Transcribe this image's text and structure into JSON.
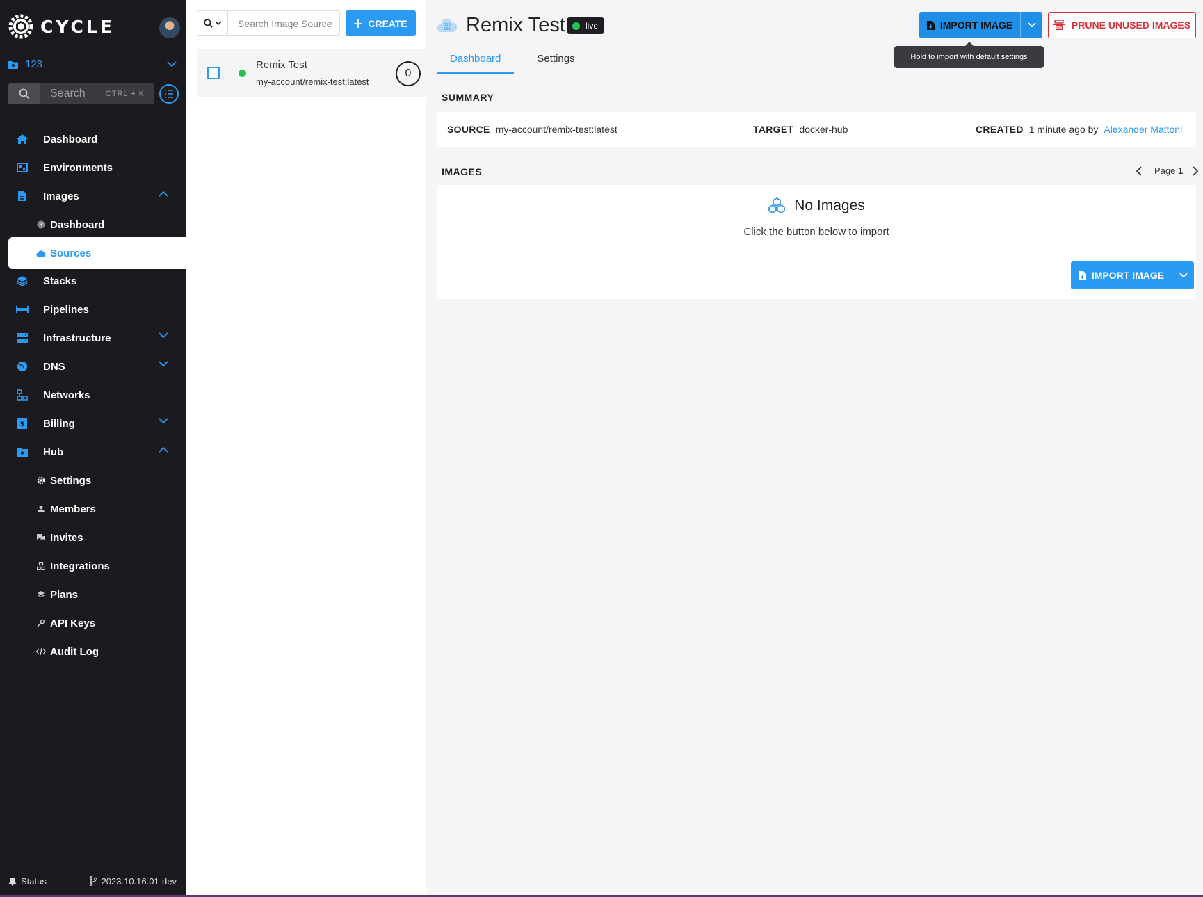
{
  "brand": {
    "name": "CYCLE",
    "logo_icon": "cycle-logo-icon"
  },
  "hub": {
    "name": "123"
  },
  "sidebar_search": {
    "placeholder": "Search",
    "shortcut": "CTRL + K"
  },
  "nav": {
    "dashboard": "Dashboard",
    "environments": "Environments",
    "images": "Images",
    "images_dashboard": "Dashboard",
    "images_sources": "Sources",
    "stacks": "Stacks",
    "pipelines": "Pipelines",
    "infrastructure": "Infrastructure",
    "dns": "DNS",
    "networks": "Networks",
    "billing": "Billing",
    "hub": "Hub",
    "hub_settings": "Settings",
    "hub_members": "Members",
    "hub_invites": "Invites",
    "hub_integrations": "Integrations",
    "hub_plans": "Plans",
    "hub_api_keys": "API Keys",
    "hub_audit_log": "Audit Log"
  },
  "footer": {
    "status": "Status",
    "version": "2023.10.16.01-dev"
  },
  "list": {
    "search_placeholder": "Search Image Source",
    "create_label": "CREATE",
    "items": [
      {
        "name": "Remix Test",
        "origin": "my-account/remix-test:latest",
        "count": "0",
        "state_color": "#27c150"
      }
    ]
  },
  "main": {
    "title": "Remix Test",
    "state_badge": "live",
    "import_label": "IMPORT IMAGE",
    "prune_label": "PRUNE UNUSED IMAGES",
    "tooltip": "Hold to import with default settings",
    "tabs": [
      "Dashboard",
      "Settings"
    ],
    "summary": {
      "heading": "SUMMARY",
      "source_label": "SOURCE",
      "source_value": "my-account/remix-test:latest",
      "target_label": "TARGET",
      "target_value": "docker-hub",
      "created_label": "CREATED",
      "created_value": "1 minute ago by",
      "created_by": "Alexander Mattoni"
    },
    "images": {
      "heading": "IMAGES",
      "page_label": "Page",
      "page_number": "1",
      "empty_title": "No Images",
      "empty_subtitle": "Click the button below to import",
      "import_label": "IMPORT IMAGE"
    }
  },
  "colors": {
    "accent": "#2b9af3",
    "sidebar_bg": "#1b1b1f",
    "danger": "#d9303a",
    "live": "#27c150"
  }
}
